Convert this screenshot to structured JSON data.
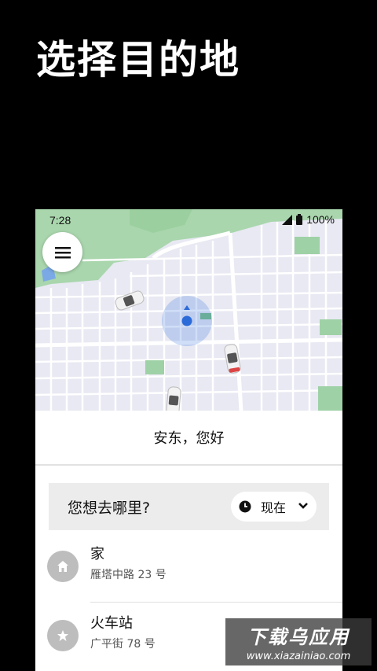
{
  "hero": {
    "title": "选择目的地"
  },
  "status_bar": {
    "time": "7:28",
    "battery": "100%"
  },
  "greeting": "安东，您好",
  "search": {
    "prompt": "您想去哪里?",
    "time_option": "现在"
  },
  "places": [
    {
      "name": "家",
      "address": "雁塔中路 23 号",
      "icon": "home-icon"
    },
    {
      "name": "火车站",
      "address": "广平街 78 号",
      "icon": "star-icon"
    }
  ],
  "watermark": {
    "title": "下载乌应用",
    "url": "www.xiazainiao.com"
  },
  "colors": {
    "map_background": "#e8e9f2",
    "park": "#9fd1a6",
    "location": "#2b6bd9"
  }
}
